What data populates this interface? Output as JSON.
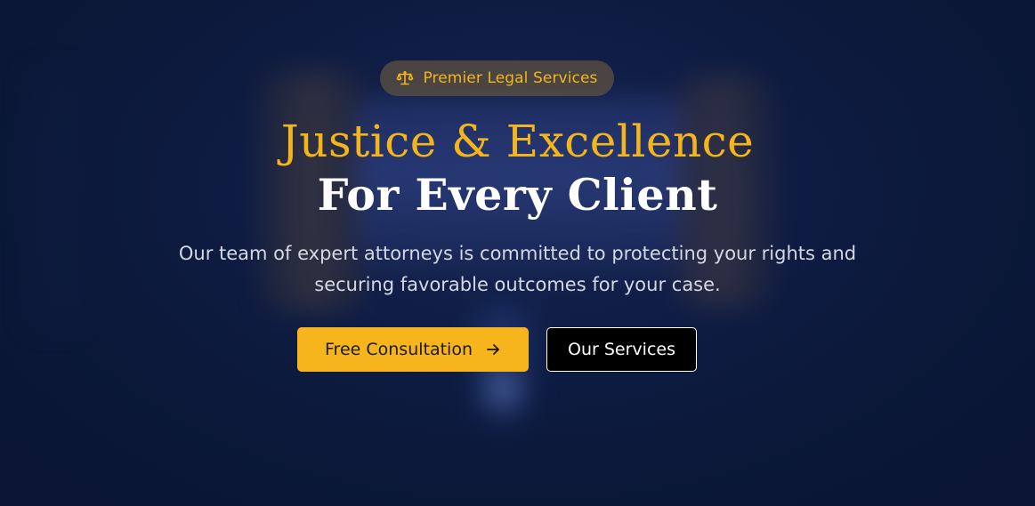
{
  "hero": {
    "badge": {
      "icon": "scale-icon",
      "text": "Premier Legal Services"
    },
    "title_line1": "Justice & Excellence",
    "title_line2": "For Every Client",
    "subtitle": "Our team of expert attorneys is committed to protecting your rights and securing favorable outcomes for your case.",
    "buttons": {
      "primary": {
        "label": "Free Consultation",
        "icon": "arrow-right-icon"
      },
      "secondary": {
        "label": "Our Services"
      }
    }
  },
  "colors": {
    "background": "#0c1a3d",
    "accent": "#f6b51d",
    "badge_bg": "#786440",
    "title_gold": "#f4b41b",
    "title_white": "#ffffff",
    "subtitle_text": "#d4d8e3",
    "secondary_button_bg": "#000000"
  }
}
